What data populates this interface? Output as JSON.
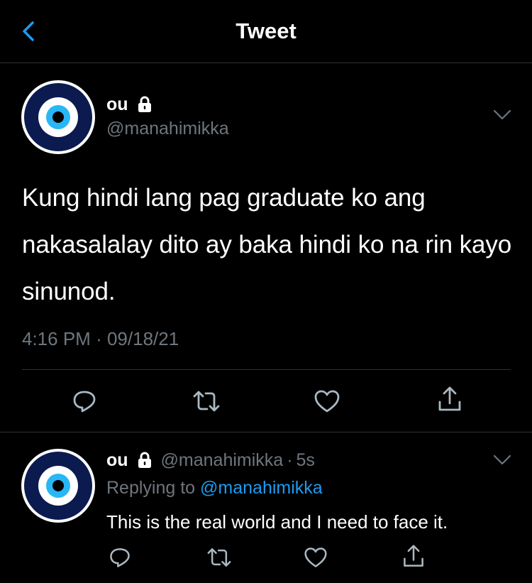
{
  "header": {
    "title": "Tweet"
  },
  "tweet": {
    "display_name": "ou",
    "handle": "@manahimikka",
    "text": "Kung hindi lang pag graduate ko ang nakasalalay dito ay baka hindi ko na rin kayo sinunod.",
    "time": "4:16 PM",
    "separator": "·",
    "date": "09/18/21"
  },
  "reply": {
    "display_name": "ou",
    "handle": "@manahimikka",
    "separator": "·",
    "age": "5s",
    "replying_prefix": "Replying to",
    "replying_to": "@manahimikka",
    "text": "This is the real world and I need to face it."
  },
  "icons": {
    "back": "chevron-left-icon",
    "lock": "lock-icon",
    "more": "chevron-down-icon",
    "reply": "reply-bubble-icon",
    "retweet": "retweet-icon",
    "like": "heart-icon",
    "share": "share-icon"
  },
  "colors": {
    "background": "#000000",
    "accent": "#1d9bf0",
    "muted": "#6e767d",
    "divider": "#2f3336",
    "avatar_ring": "#0b1b4f",
    "avatar_iris": "#29b6f6"
  }
}
